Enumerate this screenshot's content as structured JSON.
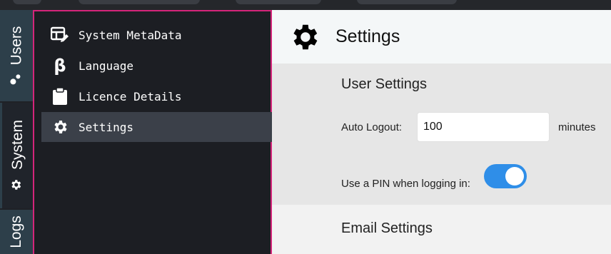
{
  "rail": {
    "tabs": [
      {
        "label": "Users",
        "icon": "user-icon"
      },
      {
        "label": "System",
        "icon": "gear-icon"
      },
      {
        "label": "Logs",
        "icon": ""
      }
    ]
  },
  "subnav": {
    "items": [
      {
        "label": "System MetaData",
        "icon": "table-edit-icon"
      },
      {
        "label": "Language",
        "icon": "beta-icon",
        "glyph": "β"
      },
      {
        "label": "Licence Details",
        "icon": "clipboard-icon"
      },
      {
        "label": "Settings",
        "icon": "gear-icon",
        "active": true
      }
    ]
  },
  "main": {
    "title": "Settings",
    "user_settings": {
      "title": "User Settings",
      "auto_logout_label": "Auto Logout:",
      "auto_logout_value": "100",
      "auto_logout_unit": "minutes",
      "pin_label": "Use a PIN when logging in:",
      "pin_enabled": true
    },
    "email_settings": {
      "title": "Email Settings"
    }
  },
  "colors": {
    "accent_border": "#d4257a",
    "toggle_on": "#2f8ee8",
    "rail_tab": "#2d3f4a"
  }
}
